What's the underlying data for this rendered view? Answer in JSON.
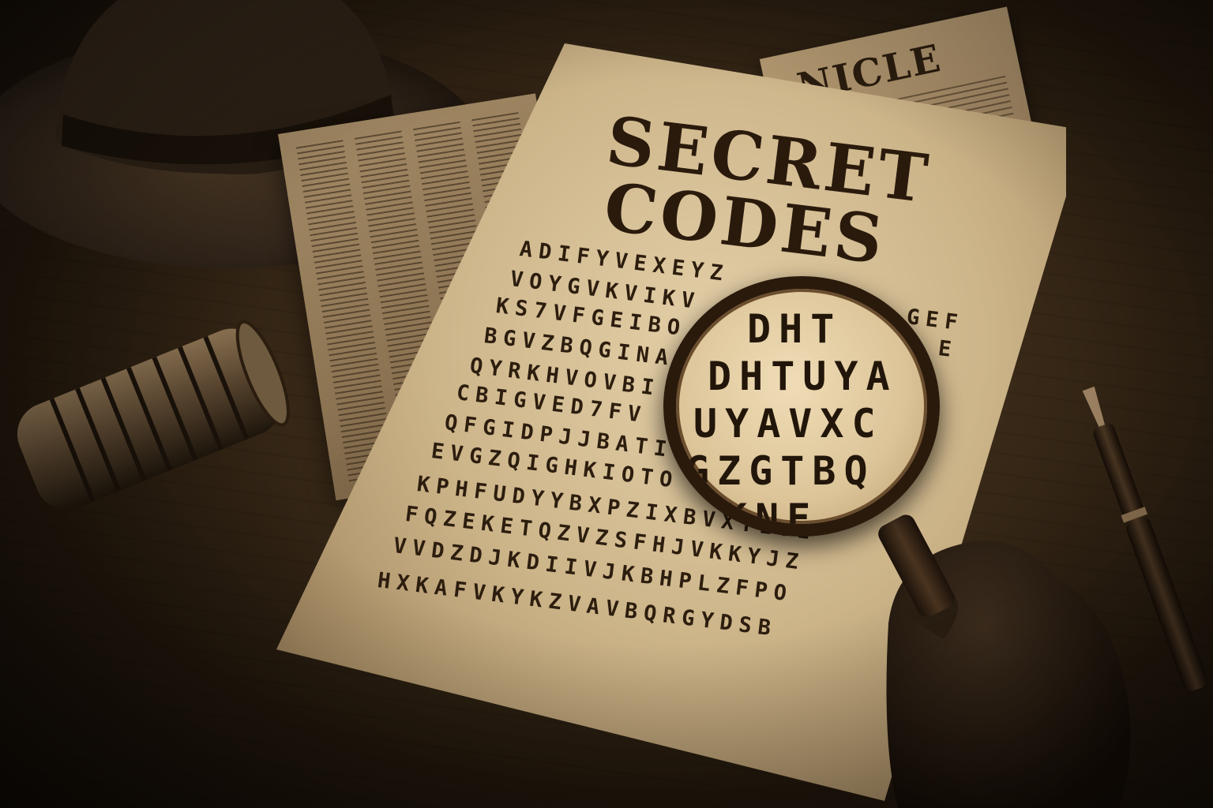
{
  "document": {
    "title_line1": "SECRET",
    "title_line2": "CODES",
    "code_rows": [
      "ADIFYVEXEYZ",
      "VOYGVKVIKV",
      "KS7VFGEIBO",
      "BGVZBQGINA",
      "QYRKHVOVBI",
      "CBIGVED7FV",
      "QFGIDPJJBATI",
      "EVGZQIGHKIOTO",
      "KPHFUDYYBXPZIXBVXYLVE",
      "FQZEKETQZVZSFHJVKKYJZ",
      "VVDZDJKDIIVJKBHPLZFPO",
      "HXKAFVKYKZVAVBQRGYDSB",
      "HXKAFVKYKZVAVBQRGYDSB"
    ],
    "right_fragments": [
      "GEF",
      "E"
    ]
  },
  "magnifier": {
    "rows": [
      "DHT",
      "DHTUYA",
      "UYAVXC",
      "GZGTBQ",
      "KNE"
    ]
  },
  "newspaper": {
    "masthead": "NICLE"
  },
  "colors": {
    "paper": "#d6bf95",
    "ink": "#2a1a0c",
    "desk": "#3a2a18"
  }
}
